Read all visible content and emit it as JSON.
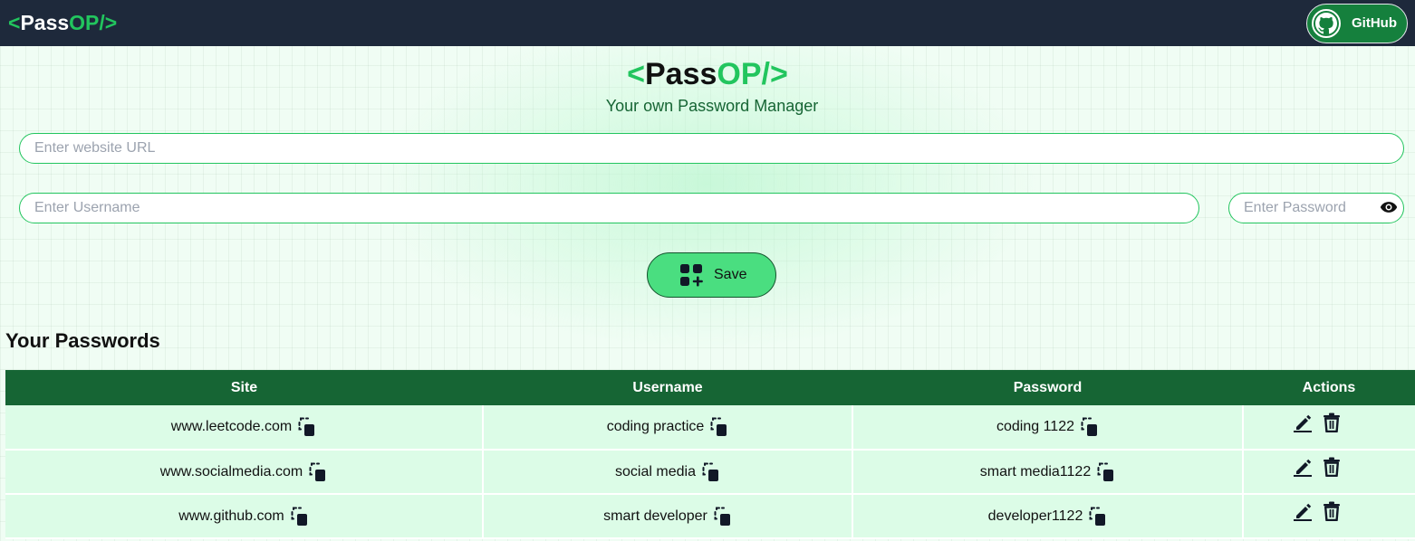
{
  "navbar": {
    "logo": {
      "open": "<",
      "pass": "Pass",
      "op": "OP/>"
    },
    "github_label": "GitHub"
  },
  "header": {
    "title": {
      "open": "<",
      "pass": "Pass",
      "op": "OP/>"
    },
    "subtitle": "Your own Password Manager"
  },
  "form": {
    "url_placeholder": "Enter website URL",
    "username_placeholder": "Enter Username",
    "password_placeholder": "Enter Password",
    "save_label": "Save"
  },
  "passwords": {
    "title": "Your Passwords",
    "columns": [
      "Site",
      "Username",
      "Password",
      "Actions"
    ],
    "rows": [
      {
        "site": "www.leetcode.com",
        "username": "coding practice",
        "password": "coding 1122"
      },
      {
        "site": "www.socialmedia.com",
        "username": "social media",
        "password": "smart media1122"
      },
      {
        "site": "www.github.com",
        "username": "smart developer",
        "password": "developer1122"
      }
    ]
  },
  "icons": {
    "github": "github-icon",
    "eye": "eye-icon",
    "save": "add-grid-icon",
    "copy": "copy-icon",
    "edit": "edit-icon",
    "delete": "trash-icon"
  },
  "colors": {
    "navbar_bg": "#1e293b",
    "accent_green": "#22c55e",
    "table_header": "#166534",
    "row_bg": "#dcfce7",
    "save_button": "#4ade80"
  }
}
